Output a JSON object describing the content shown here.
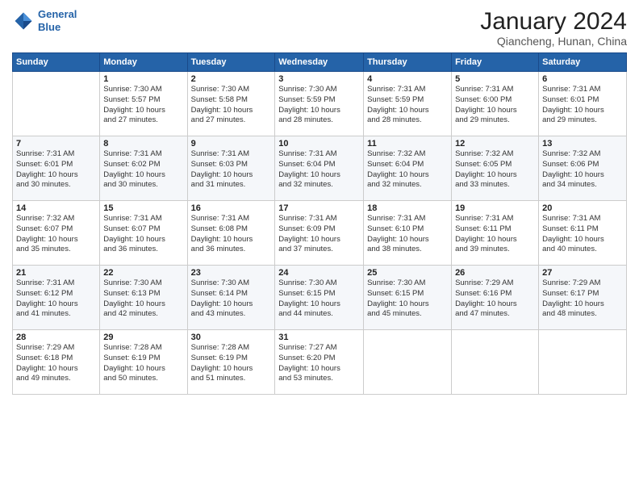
{
  "logo": {
    "line1": "General",
    "line2": "Blue"
  },
  "title": "January 2024",
  "subtitle": "Qiancheng, Hunan, China",
  "weekdays": [
    "Sunday",
    "Monday",
    "Tuesday",
    "Wednesday",
    "Thursday",
    "Friday",
    "Saturday"
  ],
  "weeks": [
    [
      {
        "day": "",
        "sunrise": "",
        "sunset": "",
        "daylight": ""
      },
      {
        "day": "1",
        "sunrise": "Sunrise: 7:30 AM",
        "sunset": "Sunset: 5:57 PM",
        "daylight": "Daylight: 10 hours and 27 minutes."
      },
      {
        "day": "2",
        "sunrise": "Sunrise: 7:30 AM",
        "sunset": "Sunset: 5:58 PM",
        "daylight": "Daylight: 10 hours and 27 minutes."
      },
      {
        "day": "3",
        "sunrise": "Sunrise: 7:30 AM",
        "sunset": "Sunset: 5:59 PM",
        "daylight": "Daylight: 10 hours and 28 minutes."
      },
      {
        "day": "4",
        "sunrise": "Sunrise: 7:31 AM",
        "sunset": "Sunset: 5:59 PM",
        "daylight": "Daylight: 10 hours and 28 minutes."
      },
      {
        "day": "5",
        "sunrise": "Sunrise: 7:31 AM",
        "sunset": "Sunset: 6:00 PM",
        "daylight": "Daylight: 10 hours and 29 minutes."
      },
      {
        "day": "6",
        "sunrise": "Sunrise: 7:31 AM",
        "sunset": "Sunset: 6:01 PM",
        "daylight": "Daylight: 10 hours and 29 minutes."
      }
    ],
    [
      {
        "day": "7",
        "sunrise": "Sunrise: 7:31 AM",
        "sunset": "Sunset: 6:01 PM",
        "daylight": "Daylight: 10 hours and 30 minutes."
      },
      {
        "day": "8",
        "sunrise": "Sunrise: 7:31 AM",
        "sunset": "Sunset: 6:02 PM",
        "daylight": "Daylight: 10 hours and 30 minutes."
      },
      {
        "day": "9",
        "sunrise": "Sunrise: 7:31 AM",
        "sunset": "Sunset: 6:03 PM",
        "daylight": "Daylight: 10 hours and 31 minutes."
      },
      {
        "day": "10",
        "sunrise": "Sunrise: 7:31 AM",
        "sunset": "Sunset: 6:04 PM",
        "daylight": "Daylight: 10 hours and 32 minutes."
      },
      {
        "day": "11",
        "sunrise": "Sunrise: 7:32 AM",
        "sunset": "Sunset: 6:04 PM",
        "daylight": "Daylight: 10 hours and 32 minutes."
      },
      {
        "day": "12",
        "sunrise": "Sunrise: 7:32 AM",
        "sunset": "Sunset: 6:05 PM",
        "daylight": "Daylight: 10 hours and 33 minutes."
      },
      {
        "day": "13",
        "sunrise": "Sunrise: 7:32 AM",
        "sunset": "Sunset: 6:06 PM",
        "daylight": "Daylight: 10 hours and 34 minutes."
      }
    ],
    [
      {
        "day": "14",
        "sunrise": "Sunrise: 7:32 AM",
        "sunset": "Sunset: 6:07 PM",
        "daylight": "Daylight: 10 hours and 35 minutes."
      },
      {
        "day": "15",
        "sunrise": "Sunrise: 7:31 AM",
        "sunset": "Sunset: 6:07 PM",
        "daylight": "Daylight: 10 hours and 36 minutes."
      },
      {
        "day": "16",
        "sunrise": "Sunrise: 7:31 AM",
        "sunset": "Sunset: 6:08 PM",
        "daylight": "Daylight: 10 hours and 36 minutes."
      },
      {
        "day": "17",
        "sunrise": "Sunrise: 7:31 AM",
        "sunset": "Sunset: 6:09 PM",
        "daylight": "Daylight: 10 hours and 37 minutes."
      },
      {
        "day": "18",
        "sunrise": "Sunrise: 7:31 AM",
        "sunset": "Sunset: 6:10 PM",
        "daylight": "Daylight: 10 hours and 38 minutes."
      },
      {
        "day": "19",
        "sunrise": "Sunrise: 7:31 AM",
        "sunset": "Sunset: 6:11 PM",
        "daylight": "Daylight: 10 hours and 39 minutes."
      },
      {
        "day": "20",
        "sunrise": "Sunrise: 7:31 AM",
        "sunset": "Sunset: 6:11 PM",
        "daylight": "Daylight: 10 hours and 40 minutes."
      }
    ],
    [
      {
        "day": "21",
        "sunrise": "Sunrise: 7:31 AM",
        "sunset": "Sunset: 6:12 PM",
        "daylight": "Daylight: 10 hours and 41 minutes."
      },
      {
        "day": "22",
        "sunrise": "Sunrise: 7:30 AM",
        "sunset": "Sunset: 6:13 PM",
        "daylight": "Daylight: 10 hours and 42 minutes."
      },
      {
        "day": "23",
        "sunrise": "Sunrise: 7:30 AM",
        "sunset": "Sunset: 6:14 PM",
        "daylight": "Daylight: 10 hours and 43 minutes."
      },
      {
        "day": "24",
        "sunrise": "Sunrise: 7:30 AM",
        "sunset": "Sunset: 6:15 PM",
        "daylight": "Daylight: 10 hours and 44 minutes."
      },
      {
        "day": "25",
        "sunrise": "Sunrise: 7:30 AM",
        "sunset": "Sunset: 6:15 PM",
        "daylight": "Daylight: 10 hours and 45 minutes."
      },
      {
        "day": "26",
        "sunrise": "Sunrise: 7:29 AM",
        "sunset": "Sunset: 6:16 PM",
        "daylight": "Daylight: 10 hours and 47 minutes."
      },
      {
        "day": "27",
        "sunrise": "Sunrise: 7:29 AM",
        "sunset": "Sunset: 6:17 PM",
        "daylight": "Daylight: 10 hours and 48 minutes."
      }
    ],
    [
      {
        "day": "28",
        "sunrise": "Sunrise: 7:29 AM",
        "sunset": "Sunset: 6:18 PM",
        "daylight": "Daylight: 10 hours and 49 minutes."
      },
      {
        "day": "29",
        "sunrise": "Sunrise: 7:28 AM",
        "sunset": "Sunset: 6:19 PM",
        "daylight": "Daylight: 10 hours and 50 minutes."
      },
      {
        "day": "30",
        "sunrise": "Sunrise: 7:28 AM",
        "sunset": "Sunset: 6:19 PM",
        "daylight": "Daylight: 10 hours and 51 minutes."
      },
      {
        "day": "31",
        "sunrise": "Sunrise: 7:27 AM",
        "sunset": "Sunset: 6:20 PM",
        "daylight": "Daylight: 10 hours and 53 minutes."
      },
      {
        "day": "",
        "sunrise": "",
        "sunset": "",
        "daylight": ""
      },
      {
        "day": "",
        "sunrise": "",
        "sunset": "",
        "daylight": ""
      },
      {
        "day": "",
        "sunrise": "",
        "sunset": "",
        "daylight": ""
      }
    ]
  ]
}
